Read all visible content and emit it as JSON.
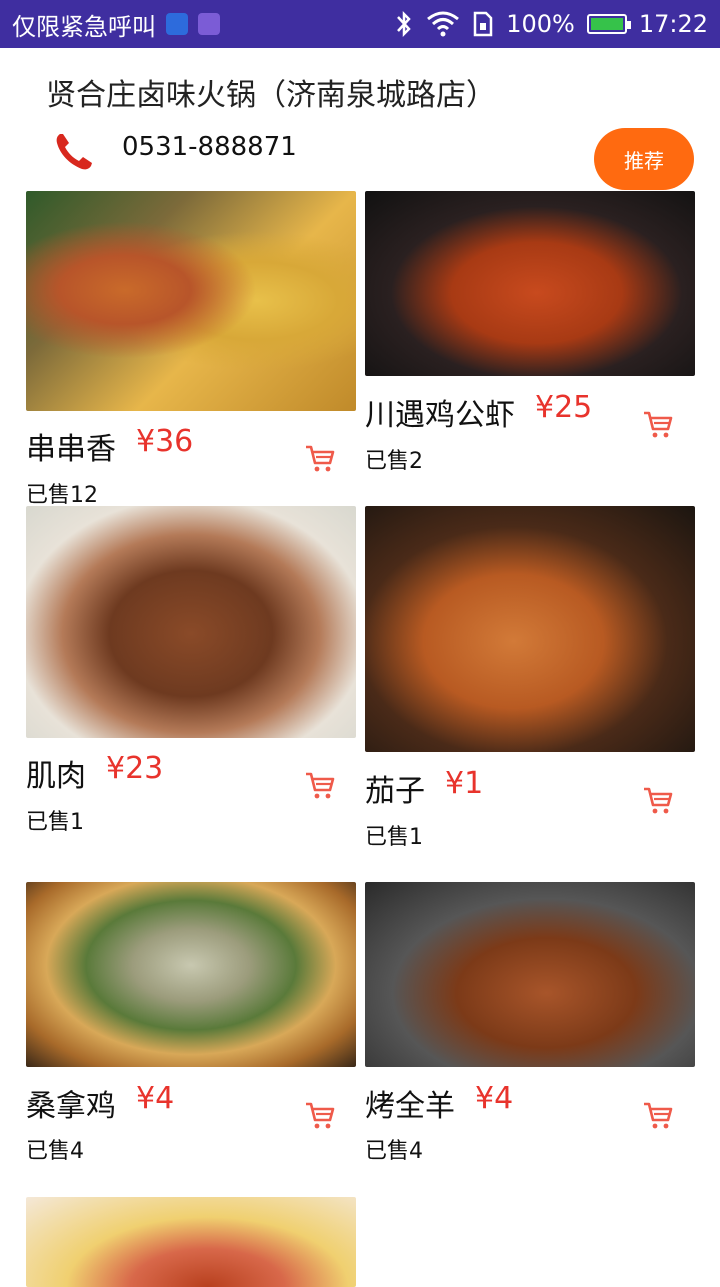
{
  "status_bar": {
    "carrier_text": "仅限紧急呼叫",
    "battery": "100%",
    "time": "17:22",
    "battery_level": 1.0
  },
  "store": {
    "name": "贤合庄卤味火锅（济南泉城路店）",
    "phone": "0531-888871",
    "recommend_label": "推荐"
  },
  "products": [
    {
      "name": "串串香",
      "price": "¥36",
      "sold": "已售12"
    },
    {
      "name": "川遇鸡公虾",
      "price": "¥25",
      "sold": "已售2"
    },
    {
      "name": "肌肉",
      "price": "¥23",
      "sold": "已售1"
    },
    {
      "name": "茄子",
      "price": "¥1",
      "sold": "已售1"
    },
    {
      "name": "桑拿鸡",
      "price": "¥4",
      "sold": "已售4"
    },
    {
      "name": "烤全羊",
      "price": "¥4",
      "sold": "已售4"
    }
  ],
  "colors": {
    "status_bar": "#3f2ea0",
    "accent": "#ff6a10",
    "price": "#e8332c"
  }
}
